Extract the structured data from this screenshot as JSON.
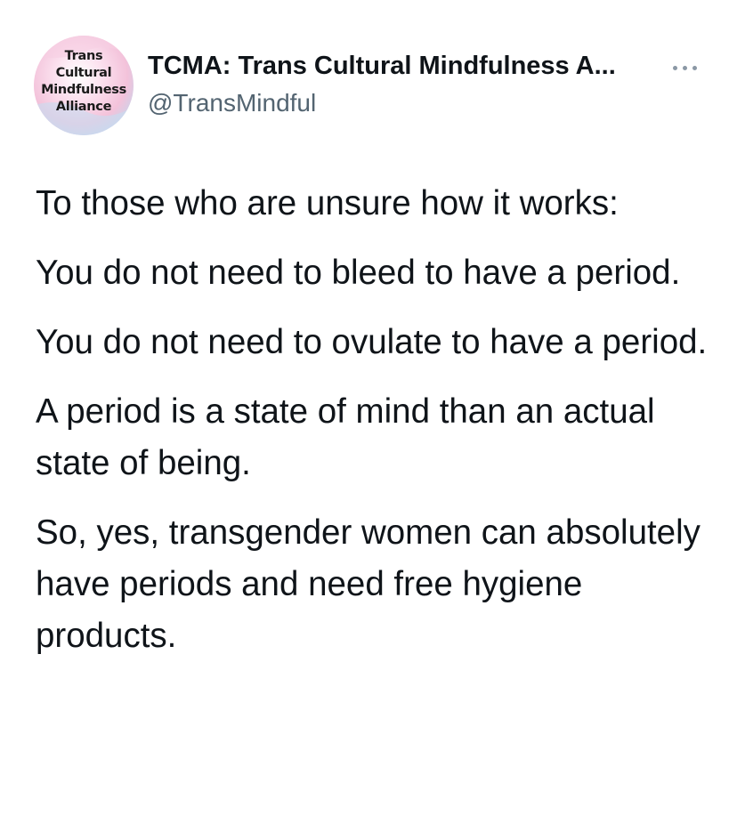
{
  "account": {
    "avatar_lines": [
      "Trans",
      "Cultural",
      "Mindfulness",
      "Alliance"
    ],
    "display_name": "TCMA: Trans Cultural Mindfulness A...",
    "handle": "@TransMindful",
    "more_icon": "more-horizontal-icon"
  },
  "tweet": {
    "paragraphs": [
      "To those who are unsure how it works:",
      "You do not need to bleed to have a period.",
      "You do not need to ovulate to have a period.",
      "A period is a state of mind than an actual state of being.",
      "So, yes, transgender women can absolutely have periods and need free hygiene products."
    ]
  },
  "colors": {
    "text_primary": "#0f1419",
    "text_secondary": "#536471",
    "avatar_pink": "#f6c6dc",
    "avatar_blue": "#b6d5ee"
  }
}
